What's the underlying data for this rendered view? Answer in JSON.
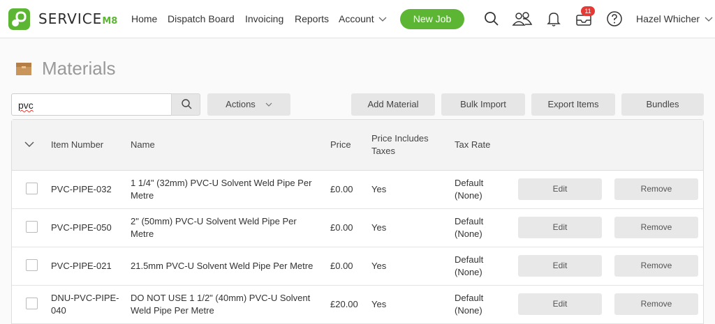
{
  "brand": {
    "name_main": "SERVICE",
    "name_suffix": "M8",
    "accent": "#5cb634"
  },
  "nav": {
    "items": [
      {
        "label": "Home"
      },
      {
        "label": "Dispatch Board"
      },
      {
        "label": "Invoicing"
      },
      {
        "label": "Reports"
      },
      {
        "label": "Account"
      }
    ],
    "new_job_label": "New Job",
    "notification_count": "11",
    "user_name": "Hazel Whicher"
  },
  "page": {
    "title": "Materials"
  },
  "toolbar": {
    "search_value": "pvc",
    "actions_label": "Actions",
    "add_material_label": "Add Material",
    "bulk_import_label": "Bulk Import",
    "export_items_label": "Export Items",
    "bundles_label": "Bundles"
  },
  "table": {
    "columns": {
      "item_number": "Item Number",
      "name": "Name",
      "price": "Price",
      "price_includes_taxes": [
        "Price Includes",
        "Taxes"
      ],
      "tax_rate": "Tax Rate"
    },
    "edit_label": "Edit",
    "remove_label": "Remove",
    "rows": [
      {
        "item_number": [
          "PVC-PIPE-032"
        ],
        "name": [
          "1 1/4\" (32mm) PVC-U Solvent Weld Pipe Per",
          "Metre"
        ],
        "price": "£0.00",
        "taxes": "Yes",
        "tax_rate": [
          "Default",
          "(None)"
        ]
      },
      {
        "item_number": [
          "PVC-PIPE-050"
        ],
        "name": [
          "2\" (50mm) PVC-U Solvent Weld Pipe Per",
          "Metre"
        ],
        "price": "£0.00",
        "taxes": "Yes",
        "tax_rate": [
          "Default",
          "(None)"
        ]
      },
      {
        "item_number": [
          "PVC-PIPE-021"
        ],
        "name": [
          "21.5mm PVC-U Solvent Weld Pipe Per Metre"
        ],
        "price": "£0.00",
        "taxes": "Yes",
        "tax_rate": [
          "Default",
          "(None)"
        ]
      },
      {
        "item_number": [
          "DNU-PVC-PIPE-",
          "040"
        ],
        "name": [
          "DO NOT USE 1 1/2\" (40mm) PVC-U Solvent",
          "Weld Pipe Per Metre"
        ],
        "price": "£20.00",
        "taxes": "Yes",
        "tax_rate": [
          "Default",
          "(None)"
        ]
      }
    ]
  }
}
